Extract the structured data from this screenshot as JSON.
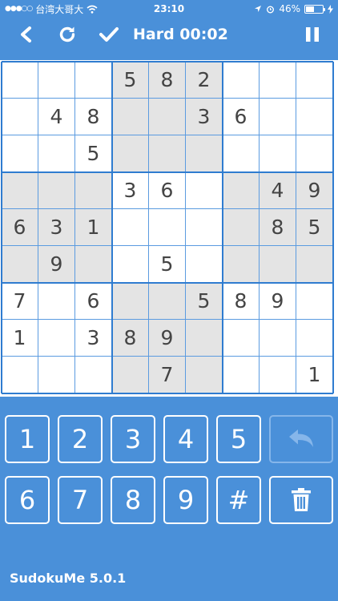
{
  "status": {
    "carrier": "台湾大哥大",
    "time": "23:10",
    "battery": "46%",
    "battery_level": 0.46
  },
  "toolbar": {
    "title": "Hard 00:02"
  },
  "board": [
    [
      "",
      "",
      "",
      "5",
      "8",
      "2",
      "",
      "",
      ""
    ],
    [
      "",
      "4",
      "8",
      "",
      "",
      "3",
      "6",
      "",
      ""
    ],
    [
      "",
      "",
      "5",
      "",
      "",
      "",
      "",
      "",
      ""
    ],
    [
      "",
      "",
      "",
      "3",
      "6",
      "",
      "",
      "4",
      "9"
    ],
    [
      "6",
      "3",
      "1",
      "",
      "",
      "",
      "",
      "8",
      "5"
    ],
    [
      "",
      "9",
      "",
      "",
      "5",
      "",
      "",
      "",
      ""
    ],
    [
      "7",
      "",
      "6",
      "",
      "",
      "5",
      "8",
      "9",
      ""
    ],
    [
      "1",
      "",
      "3",
      "8",
      "9",
      "",
      "",
      "",
      ""
    ],
    [
      "",
      "",
      "",
      "",
      "7",
      "",
      "",
      "",
      "1"
    ]
  ],
  "keypad": {
    "row1": [
      "1",
      "2",
      "3",
      "4",
      "5"
    ],
    "row2": [
      "6",
      "7",
      "8",
      "9",
      "#"
    ]
  },
  "icons": {
    "back": "back-chevron-icon",
    "reset": "refresh-icon",
    "check": "checkmark-icon",
    "pause": "pause-icon",
    "undo": "undo-arrow-icon",
    "delete": "trash-icon"
  },
  "colors": {
    "background": "#4a90d9",
    "shaded_cell": "#e4e4e4",
    "digit": "#444444"
  },
  "footer": {
    "version": "SudokuMe 5.0.1"
  }
}
